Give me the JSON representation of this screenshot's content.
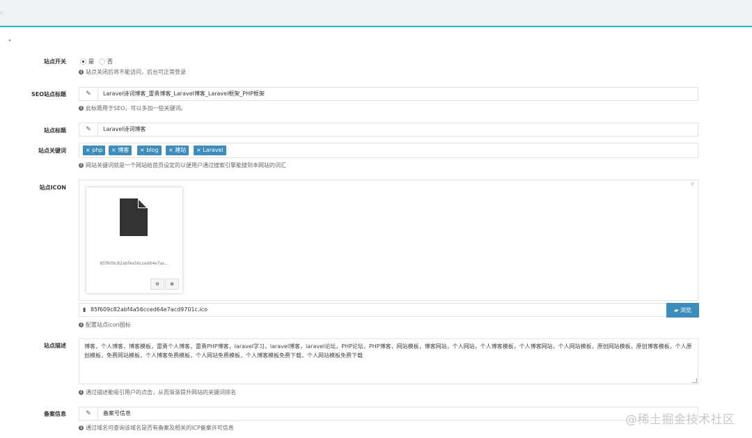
{
  "topbar": {
    "arrow": "‹"
  },
  "marker": "*",
  "site_switch": {
    "label": "站点开关",
    "opt_yes": "是",
    "opt_no": "否",
    "help": "站点关闭后将不能访问，后台可正常登录"
  },
  "seo_title": {
    "label": "SEO站点标题",
    "value": "Laravel诗词博客_雷勇博客_Laravel博客_Laravel框架_PHP框架",
    "help": "此标题用于SEO，可以多加一些关键词。"
  },
  "site_title": {
    "label": "站点标题",
    "value": "Laravel诗词博客"
  },
  "keywords": {
    "label": "站点关键词",
    "tags": [
      "× php",
      "× 博客",
      "× blog",
      "× 建站",
      "× Laravel"
    ],
    "help": "网站关键词就是一个网站给首页设定的以便用户通过搜索引擎能搜到本网站的词汇"
  },
  "icon": {
    "label": "站点ICON",
    "close": "×",
    "thumb_caption": "85f609c82abf4a56cced64e7ac...",
    "btn_remove": "⊖",
    "btn_zoom": "⊕",
    "file_name": "85f609c82abf4a56cced64e7acd9701c.ico",
    "browse": "浏览",
    "help": "配置站点icon图标"
  },
  "description": {
    "label": "站点描述",
    "value": "博客，个人博客，博客模板，雷勇个人博客，雷勇PHP博客，laravel学习，laravel博客，laravel论坛，PHP论坛，PHP博客，网站模板，博客网站，个人网站，个人博客模板，个人博客网站，个人网站模板，原创网站模板，原创博客模板，个人原创模板，免费网站模板，个人博客免费模板，个人网站免费模板，个人博客模板免费下载，个人网站模板免费下载",
    "help": "通过描述能吸引用户的点击，从而渐渐提升网站的关键词排名"
  },
  "icp": {
    "label": "备案信息",
    "placeholder": "备案号信息",
    "help": "通过域名可查询该域名是否有备案及相关的ICP备案许可信息"
  },
  "watermark": "@稀土掘金技术社区"
}
